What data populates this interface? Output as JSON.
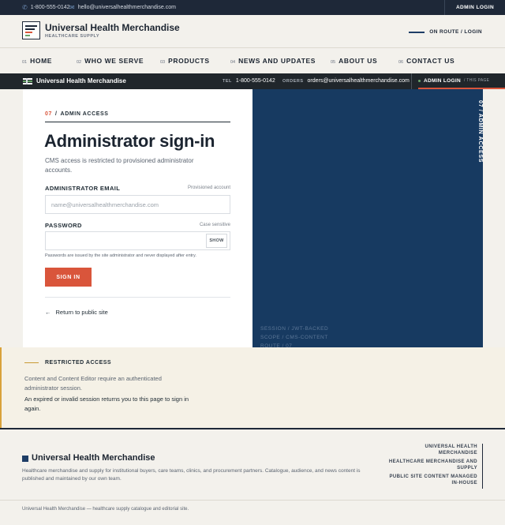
{
  "topbar": {
    "phone": "1-800-555-0142",
    "email": "hello@universalhealthmerchandise.com",
    "admin_login": "ADMIN LOGIN"
  },
  "brand": {
    "name": "Universal Health Merchandise",
    "tagline": "HEALTHCARE SUPPLY",
    "route_status": "ON ROUTE / LOGIN"
  },
  "nav": [
    {
      "num": "01",
      "label": "HOME"
    },
    {
      "num": "02",
      "label": "WHO WE SERVE"
    },
    {
      "num": "03",
      "label": "PRODUCTS"
    },
    {
      "num": "04",
      "label": "NEWS AND UPDATES"
    },
    {
      "num": "05",
      "label": "ABOUT US"
    },
    {
      "num": "06",
      "label": "CONTACT US"
    }
  ],
  "strip": {
    "name": "Universal Health Merchandise",
    "tel_key": "TEL",
    "tel": "1-800-555-0142",
    "orders_key": "ORDERS",
    "orders": "orders@universalhealthmerchandise.com",
    "admin_tab": "ADMIN LOGIN",
    "admin_tab_sub": "/ THIS PAGE"
  },
  "form": {
    "step_num": "07",
    "step_sep": "/",
    "step_label": "ADMIN ACCESS",
    "title": "Administrator sign-in",
    "description": "CMS access is restricted to provisioned administrator accounts.",
    "email_label": "ADMINISTRATOR EMAIL",
    "email_hint": "Provisioned account",
    "email_placeholder": "name@universalhealthmerchandise.com",
    "password_label": "PASSWORD",
    "password_hint": "Case sensitive",
    "show_label": "SHOW",
    "note": "Passwords are issued by the site administrator and never displayed after entry.",
    "submit": "SIGN IN",
    "back_arrow": "←",
    "back": "Return to public site"
  },
  "panel": {
    "vertical": "07 / ADMIN ACCESS",
    "meta": [
      "SESSION / JWT-BACKED",
      "SCOPE / CMS-CONTENT",
      "ROUTE / 07"
    ]
  },
  "restricted": {
    "heading": "RESTRICTED ACCESS",
    "p1": "Content and Content Editor require an authenticated administrator session.",
    "p2": "An expired or invalid session returns you to this page to sign in again."
  },
  "footer": {
    "name": "Universal Health Merchandise",
    "description": "Healthcare merchandise and supply for institutional buyers, care teams, clinics, and procurement partners. Catalogue, audience, and news content is published and maintained by our own team.",
    "links": [
      "UNIVERSAL HEALTH MERCHANDISE",
      "HEALTHCARE MERCHANDISE AND SUPPLY",
      "PUBLIC SITE CONTENT MANAGED IN-HOUSE"
    ],
    "copyright": "Universal Health Merchandise — healthcare supply catalogue and editorial site."
  },
  "colors": {
    "accent": "#d9553b",
    "navy": "#173a61",
    "dark": "#20262b",
    "gold": "#d9a23b"
  }
}
